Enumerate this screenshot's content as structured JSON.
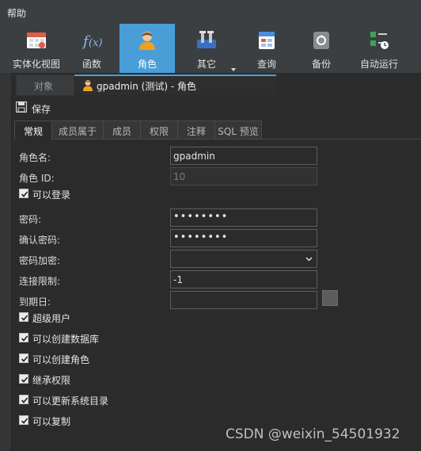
{
  "menubar": {
    "help": "帮助"
  },
  "toolbar": {
    "items": [
      {
        "label": "实体化视图"
      },
      {
        "label": "函数"
      },
      {
        "label": "角色"
      },
      {
        "label": "其它"
      },
      {
        "label": "查询"
      },
      {
        "label": "备份"
      },
      {
        "label": "自动运行"
      }
    ],
    "active": "角色"
  },
  "doctabs": {
    "objects": "对象",
    "current": "gpadmin (测试) - 角色"
  },
  "savebar": {
    "save": "保存"
  },
  "subtabs": [
    "常规",
    "成员属于",
    "成员",
    "权限",
    "注释",
    "SQL 预览"
  ],
  "form": {
    "role_name_label": "角色名:",
    "role_name_value": "gpadmin",
    "role_id_label": "角色 ID:",
    "role_id_value": "10",
    "can_login_label": "可以登录",
    "password_label": "密码:",
    "password_value": "••••••••",
    "confirm_password_label": "确认密码:",
    "confirm_password_value": "••••••••",
    "encryption_label": "密码加密:",
    "encryption_value": "",
    "conn_limit_label": "连接限制:",
    "conn_limit_value": "-1",
    "expiry_label": "到期日:",
    "expiry_value": "",
    "superuser_label": "超级用户",
    "create_db_label": "可以创建数据库",
    "create_role_label": "可以创建角色",
    "inherit_label": "继承权限",
    "update_catalog_label": "可以更新系统目录",
    "replication_label": "可以复制"
  },
  "checks": {
    "can_login": true,
    "superuser": true,
    "create_db": true,
    "create_role": true,
    "inherit": true,
    "update_catalog": true,
    "replication": true
  },
  "watermark": "CSDN @weixin_54501932",
  "colors": {
    "accent": "#4a9ed8",
    "background": "#2b2b2b",
    "toolbar": "#3c3f41"
  }
}
